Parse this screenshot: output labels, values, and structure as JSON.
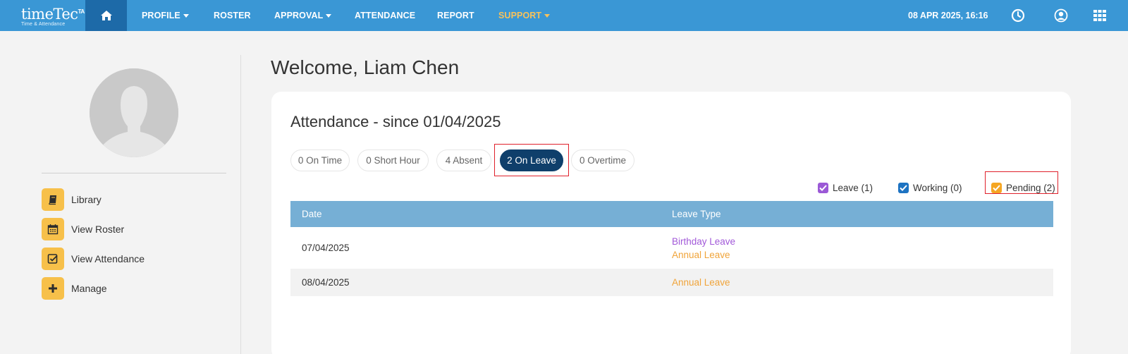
{
  "brand": {
    "name": "timeTec",
    "sup": "TA",
    "tagline": "Time & Attendance"
  },
  "nav": {
    "items": [
      {
        "label": "PROFILE",
        "dropdown": true
      },
      {
        "label": "ROSTER",
        "dropdown": false
      },
      {
        "label": "APPROVAL",
        "dropdown": true
      },
      {
        "label": "ATTENDANCE",
        "dropdown": false
      },
      {
        "label": "REPORT",
        "dropdown": false
      },
      {
        "label": "SUPPORT",
        "dropdown": true
      }
    ],
    "datetime": "08 APR 2025, 16:16",
    "support_color": "#f7c25b"
  },
  "sidebar": {
    "items": [
      {
        "label": "Library",
        "icon": "book-icon"
      },
      {
        "label": "View Roster",
        "icon": "calendar-icon"
      },
      {
        "label": "View Attendance",
        "icon": "checkbox-icon"
      },
      {
        "label": "Manage",
        "icon": "plus-icon"
      }
    ]
  },
  "welcome": "Welcome, Liam Chen",
  "attendance": {
    "title": "Attendance - since 01/04/2025",
    "filters": [
      {
        "label": "0 On Time",
        "active": false
      },
      {
        "label": "0 Short Hour",
        "active": false
      },
      {
        "label": "4 Absent",
        "active": false
      },
      {
        "label": "2 On Leave",
        "active": true
      },
      {
        "label": "0 Overtime",
        "active": false
      }
    ],
    "legend": [
      {
        "label": "Leave (1)",
        "color": "#9b59d6",
        "checked": true
      },
      {
        "label": "Working (0)",
        "color": "#1d73c2",
        "checked": true
      },
      {
        "label": "Pending (2)",
        "color": "#f5a623",
        "checked": true
      }
    ],
    "table": {
      "headers": [
        "Date",
        "Leave Type"
      ],
      "rows": [
        {
          "date": "07/04/2025",
          "leaves": [
            {
              "type": "Birthday Leave",
              "color": "#a259d9"
            },
            {
              "type": "Annual Leave",
              "color": "#f0a43a"
            }
          ]
        },
        {
          "date": "08/04/2025",
          "leaves": [
            {
              "type": "Annual Leave",
              "color": "#f0a43a"
            }
          ]
        }
      ]
    }
  },
  "colors": {
    "nav_bg": "#3a97d5",
    "home_bg": "#1d6aa8",
    "active_pill": "#0f3f6b",
    "table_header": "#76afd5",
    "sidebar_icon_bg": "#f7c04a",
    "highlight": "#e0212b"
  }
}
